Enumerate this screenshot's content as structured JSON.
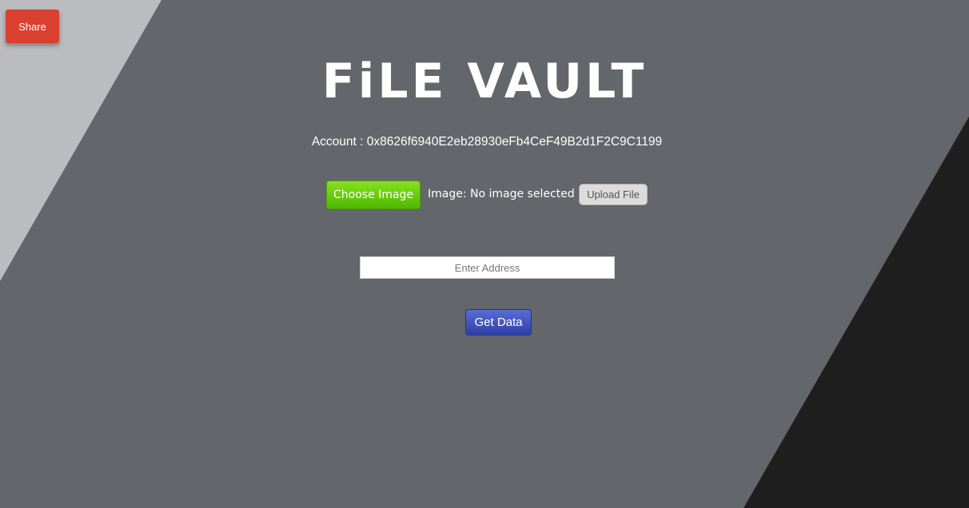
{
  "share": {
    "label": "Share"
  },
  "header": {
    "title": "FiLE VAULT"
  },
  "account": {
    "label": "Account :",
    "address": "0x8626f6940E2eb28930eFb4CeF49B2d1F2C9C1199"
  },
  "upload": {
    "choose_label": "Choose Image",
    "status_text": "Image: No image selected",
    "upload_label": "Upload File"
  },
  "lookup": {
    "address_placeholder": "Enter Address",
    "address_value": "",
    "get_data_label": "Get Data"
  },
  "colors": {
    "background": "#63666a",
    "left_band": "#bbbcbf",
    "right_band": "#1f1f1f",
    "share_button": "#d9402f",
    "choose_button": "#5cc80a",
    "get_data_button": "#3a4bb8"
  }
}
